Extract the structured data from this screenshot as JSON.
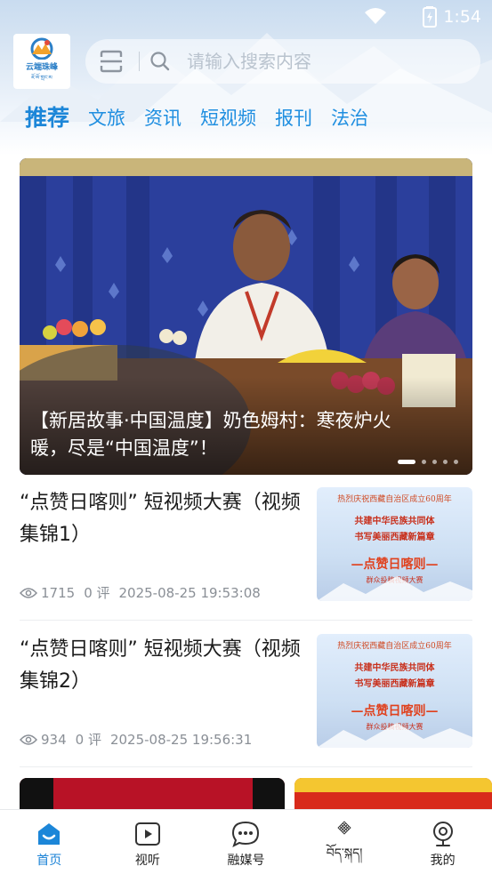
{
  "status_bar": {
    "time": "1:54"
  },
  "header": {
    "logo": {
      "name": "云端珠峰",
      "tibetan": "ཇོ་མོ་གླང་མ"
    },
    "search": {
      "placeholder": "请输入搜索内容"
    }
  },
  "tabs": [
    {
      "label": "推荐",
      "active": true
    },
    {
      "label": "文旅",
      "active": false
    },
    {
      "label": "资讯",
      "active": false
    },
    {
      "label": "短视频",
      "active": false
    },
    {
      "label": "报刊",
      "active": false
    },
    {
      "label": "法治",
      "active": false
    }
  ],
  "banner": {
    "caption": "【新居故事·中国温度】奶色姆村：寒夜炉火暖，尽是“中国温度”！",
    "slide_count": 5,
    "active_slide": 1
  },
  "news": [
    {
      "title": "“点赞日喀则” 短视频大赛（视频集锦1）",
      "views": "1715",
      "comments": "0 评",
      "time": "2025-08-25 19:53:08",
      "thumb": {
        "line1": "热烈庆祝西藏自治区成立60周年",
        "line2": "共建中华民族共同体",
        "line3": "书写美丽西藏新篇章",
        "line4": "—点赞日喀则—",
        "line5": "群众投稿视频大赛"
      }
    },
    {
      "title": "“点赞日喀则” 短视频大赛（视频集锦2）",
      "views": "934",
      "comments": "0 评",
      "time": "2025-08-25 19:56:31",
      "thumb": {
        "line1": "热烈庆祝西藏自治区成立60周年",
        "line2": "共建中华民族共同体",
        "line3": "书写美丽西藏新篇章",
        "line4": "—点赞日喀则—",
        "line5": "群众投稿视频大赛"
      }
    }
  ],
  "bottom_nav": [
    {
      "label": "首页",
      "icon": "home-icon",
      "active": true
    },
    {
      "label": "视听",
      "icon": "video-icon",
      "active": false
    },
    {
      "label": "融媒号",
      "icon": "chat-icon",
      "active": false
    },
    {
      "label": "བོད་སྐད།",
      "icon": "endless-knot-icon",
      "active": false
    },
    {
      "label": "我的",
      "icon": "profile-icon",
      "active": false
    }
  ],
  "colors": {
    "accent": "#1c86d8",
    "meta_text": "#8a8f96"
  }
}
